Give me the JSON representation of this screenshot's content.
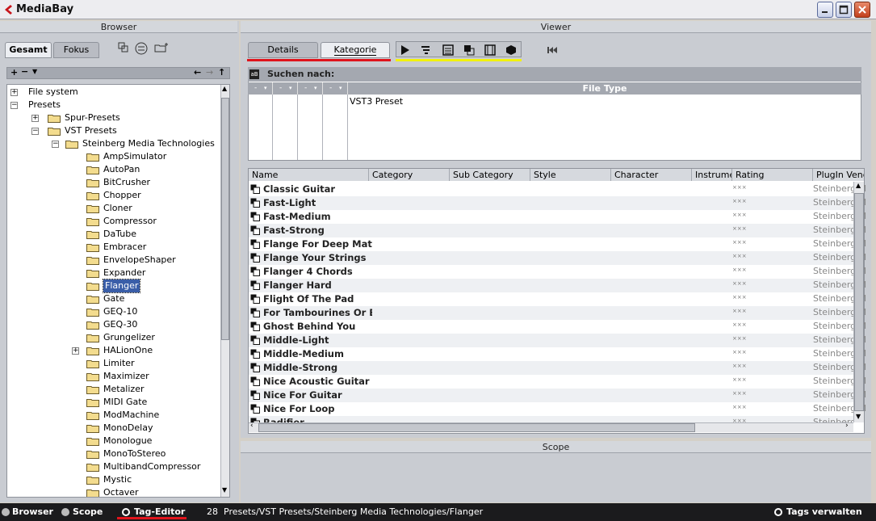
{
  "window": {
    "title": "MediaBay"
  },
  "browser": {
    "header": "Browser",
    "tabs": [
      "Gesamt",
      "Fokus"
    ],
    "toolbar_icons": [
      "copy-icon",
      "sync-icon",
      "add-folder-icon"
    ],
    "tree": [
      {
        "label": "File system",
        "level": 0,
        "expander": "+",
        "folder": false
      },
      {
        "label": "Presets",
        "level": 0,
        "expander": "-",
        "folder": false
      },
      {
        "label": "Spur-Presets",
        "level": 1,
        "expander": "+",
        "folder": true
      },
      {
        "label": "VST Presets",
        "level": 1,
        "expander": "-",
        "folder": true
      },
      {
        "label": "Steinberg Media Technologies",
        "level": 2,
        "expander": "-",
        "folder": true
      },
      {
        "label": "AmpSimulator",
        "level": 3,
        "expander": "",
        "folder": true
      },
      {
        "label": "AutoPan",
        "level": 3,
        "expander": "",
        "folder": true
      },
      {
        "label": "BitCrusher",
        "level": 3,
        "expander": "",
        "folder": true
      },
      {
        "label": "Chopper",
        "level": 3,
        "expander": "",
        "folder": true
      },
      {
        "label": "Cloner",
        "level": 3,
        "expander": "",
        "folder": true
      },
      {
        "label": "Compressor",
        "level": 3,
        "expander": "",
        "folder": true
      },
      {
        "label": "DaTube",
        "level": 3,
        "expander": "",
        "folder": true
      },
      {
        "label": "Embracer",
        "level": 3,
        "expander": "",
        "folder": true
      },
      {
        "label": "EnvelopeShaper",
        "level": 3,
        "expander": "",
        "folder": true
      },
      {
        "label": "Expander",
        "level": 3,
        "expander": "",
        "folder": true
      },
      {
        "label": "Flanger",
        "level": 3,
        "expander": "",
        "folder": true,
        "selected": true
      },
      {
        "label": "Gate",
        "level": 3,
        "expander": "",
        "folder": true
      },
      {
        "label": "GEQ-10",
        "level": 3,
        "expander": "",
        "folder": true
      },
      {
        "label": "GEQ-30",
        "level": 3,
        "expander": "",
        "folder": true
      },
      {
        "label": "Grungelizer",
        "level": 3,
        "expander": "",
        "folder": true
      },
      {
        "label": "HALionOne",
        "level": 3,
        "expander": "+",
        "folder": true
      },
      {
        "label": "Limiter",
        "level": 3,
        "expander": "",
        "folder": true
      },
      {
        "label": "Maximizer",
        "level": 3,
        "expander": "",
        "folder": true
      },
      {
        "label": "Metalizer",
        "level": 3,
        "expander": "",
        "folder": true
      },
      {
        "label": "MIDI Gate",
        "level": 3,
        "expander": "",
        "folder": true
      },
      {
        "label": "ModMachine",
        "level": 3,
        "expander": "",
        "folder": true
      },
      {
        "label": "MonoDelay",
        "level": 3,
        "expander": "",
        "folder": true
      },
      {
        "label": "Monologue",
        "level": 3,
        "expander": "",
        "folder": true
      },
      {
        "label": "MonoToStereo",
        "level": 3,
        "expander": "",
        "folder": true
      },
      {
        "label": "MultibandCompressor",
        "level": 3,
        "expander": "",
        "folder": true
      },
      {
        "label": "Mystic",
        "level": 3,
        "expander": "",
        "folder": true
      },
      {
        "label": "Octaver",
        "level": 3,
        "expander": "",
        "folder": true
      }
    ]
  },
  "viewer": {
    "header": "Viewer",
    "tabs": [
      "Details",
      "Kategorie"
    ],
    "search_label": "Suchen nach:",
    "filter_columns": [
      "-",
      "-",
      "-",
      "-"
    ],
    "file_type_header": "File Type",
    "file_type_value": "VST3 Preset",
    "columns": [
      "Name",
      "Category",
      "Sub Category",
      "Style",
      "Character",
      "Instrume",
      "Rating",
      "PlugIn Vend"
    ],
    "rating_text": "×××",
    "vendor_text": "Steinberg M",
    "rows": [
      "Classic Guitar",
      "Fast-Light",
      "Fast-Medium",
      "Fast-Strong",
      "Flange For Deep Mater",
      "Flange Your Strings",
      "Flanger 4 Chords",
      "Flanger Hard",
      "Flight Of The Pad",
      "For Tambourines Or Els",
      "Ghost Behind You",
      "Middle-Light",
      "Middle-Medium",
      "Middle-Strong",
      "Nice Acoustic Guitar",
      "Nice For Guitar",
      "Nice For Loop",
      "Radifier"
    ]
  },
  "scope": {
    "header": "Scope"
  },
  "status": {
    "browser": "Browser",
    "scope": "Scope",
    "tag_editor": "Tag-Editor",
    "count": "28",
    "path": "Presets/VST Presets/Steinberg Media Technologies/Flanger",
    "manage_tags": "Tags verwalten"
  },
  "colors": {
    "red_underline": "#e0141c",
    "yellow_underline": "#f2f20a",
    "selection": "#3a5ea8"
  }
}
